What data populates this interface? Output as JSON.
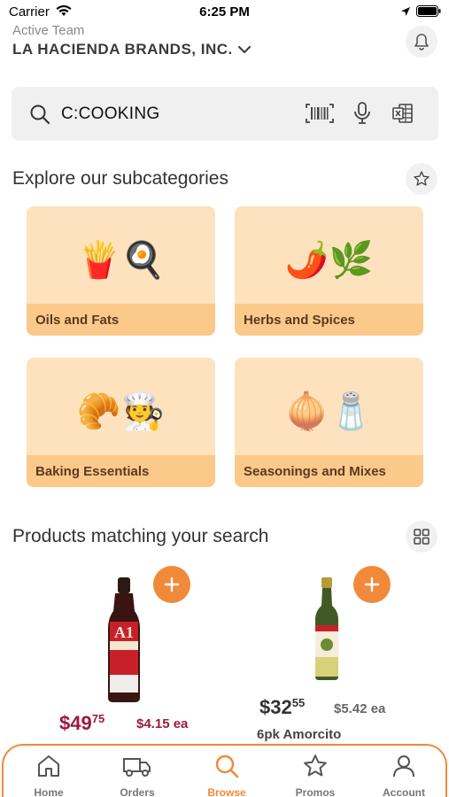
{
  "status": {
    "carrier": "Carrier",
    "time": "6:25 PM"
  },
  "header": {
    "team_label": "Active Team",
    "company": "LA HACIENDA BRANDS, INC."
  },
  "search": {
    "query": "C:COOKING"
  },
  "subcategories": {
    "title": "Explore our subcategories",
    "items": [
      {
        "label": "Oils and Fats",
        "emojis": "🍟🍳"
      },
      {
        "label": "Herbs and Spices",
        "emojis": "🌶️🌿"
      },
      {
        "label": "Baking Essentials",
        "emojis": "🥐🧑‍🍳"
      },
      {
        "label": "Seasonings and Mixes",
        "emojis": "🧅🧂"
      }
    ]
  },
  "products": {
    "title": "Products matching your search",
    "items": [
      {
        "price_dollars": "$49",
        "price_cents": "75",
        "price_each": "$4.15 ea",
        "name": "",
        "price_color": "#9b1b3c"
      },
      {
        "price_dollars": "$32",
        "price_cents": "55",
        "price_each": "$5.42 ea",
        "name": "6pk Amorcito",
        "price_color": "#333333"
      }
    ]
  },
  "tabs": [
    {
      "label": "Home",
      "icon": "home-icon"
    },
    {
      "label": "Orders",
      "icon": "truck-icon"
    },
    {
      "label": "Browse",
      "icon": "search-icon",
      "active": true
    },
    {
      "label": "Promos",
      "icon": "star-icon"
    },
    {
      "label": "Account",
      "icon": "person-icon"
    }
  ],
  "colors": {
    "accent": "#f08a3a",
    "card_bg": "#fde2bd",
    "card_label_bg": "#fbc98a"
  }
}
